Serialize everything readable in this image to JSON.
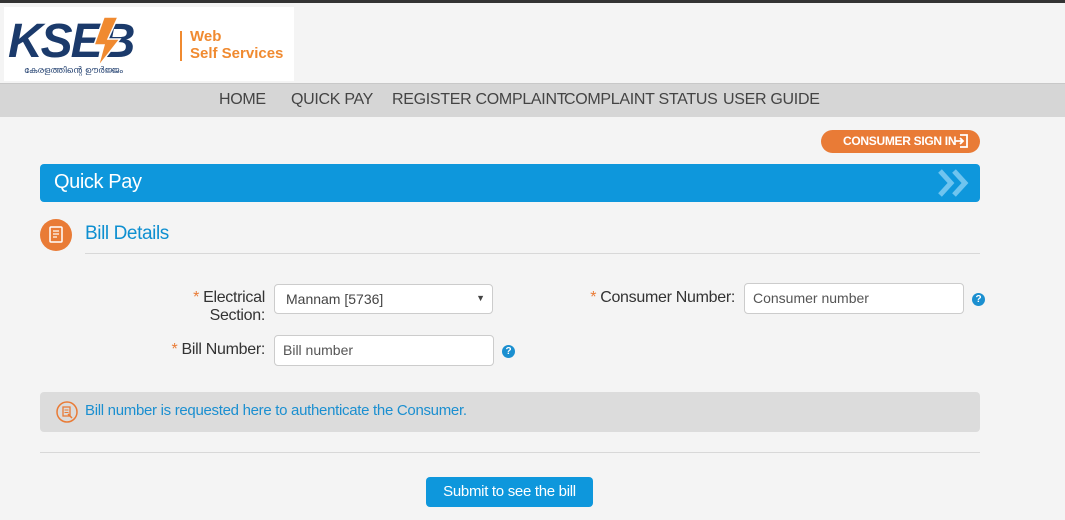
{
  "header": {
    "logo_text": "KSEB",
    "logo_tagline": "കേരളത്തിന്റെ ഊർജ്ജം",
    "web_label": "Web",
    "self_services_label": "Self Services"
  },
  "nav": {
    "items": [
      {
        "label": "HOME"
      },
      {
        "label": "QUICK PAY"
      },
      {
        "label": "REGISTER COMPLAINT"
      },
      {
        "label": "COMPLAINT STATUS"
      },
      {
        "label": "USER GUIDE"
      }
    ]
  },
  "signin": {
    "label": "CONSUMER SIGN IN",
    "icon": "sign-in-icon"
  },
  "section": {
    "title": "Quick Pay"
  },
  "bill_details": {
    "title": "Bill Details",
    "icon": "bill-document-icon"
  },
  "form": {
    "required_marker": "*",
    "electrical_section_label": "Electrical Section:",
    "electrical_section_value": "Mannam [5736]",
    "consumer_number_label": "Consumer Number:",
    "consumer_number_placeholder": "Consumer number",
    "bill_number_label": "Bill Number:",
    "bill_number_placeholder": "Bill number",
    "help_glyph": "?"
  },
  "info": {
    "text": "Bill number is requested here to authenticate the Consumer.",
    "icon": "info-note-icon"
  },
  "submit": {
    "label": "Submit to see the bill"
  },
  "colors": {
    "accent_blue": "#0e97dc",
    "accent_orange": "#e97b36",
    "logo_navy": "#1b3a6b"
  }
}
